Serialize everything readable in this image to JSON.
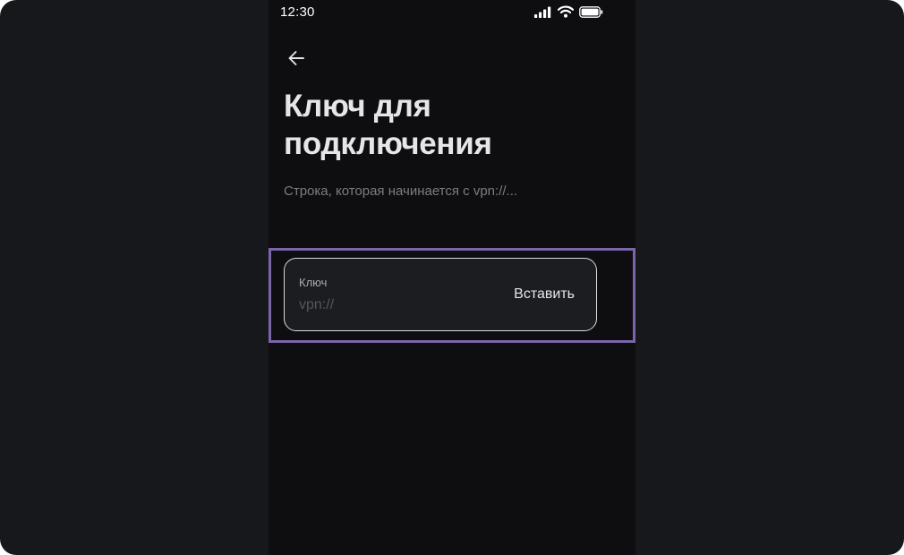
{
  "status_bar": {
    "time": "12:30",
    "icons": [
      "signal-icon",
      "wifi-icon",
      "battery-icon"
    ]
  },
  "header": {
    "back_icon": "arrow-left-icon",
    "title": "Ключ для подключения",
    "subtitle": "Строка, которая начинается с vpn://..."
  },
  "key_field": {
    "label": "Ключ",
    "value": "",
    "placeholder": "vpn://",
    "paste_label": "Вставить"
  },
  "colors": {
    "page_background": "#17181c",
    "phone_background": "#0e0e11",
    "field_background": "#1c1d21",
    "highlight": "#7b65a8",
    "text_primary": "#e6e6e8",
    "text_secondary": "#7b7c82"
  }
}
